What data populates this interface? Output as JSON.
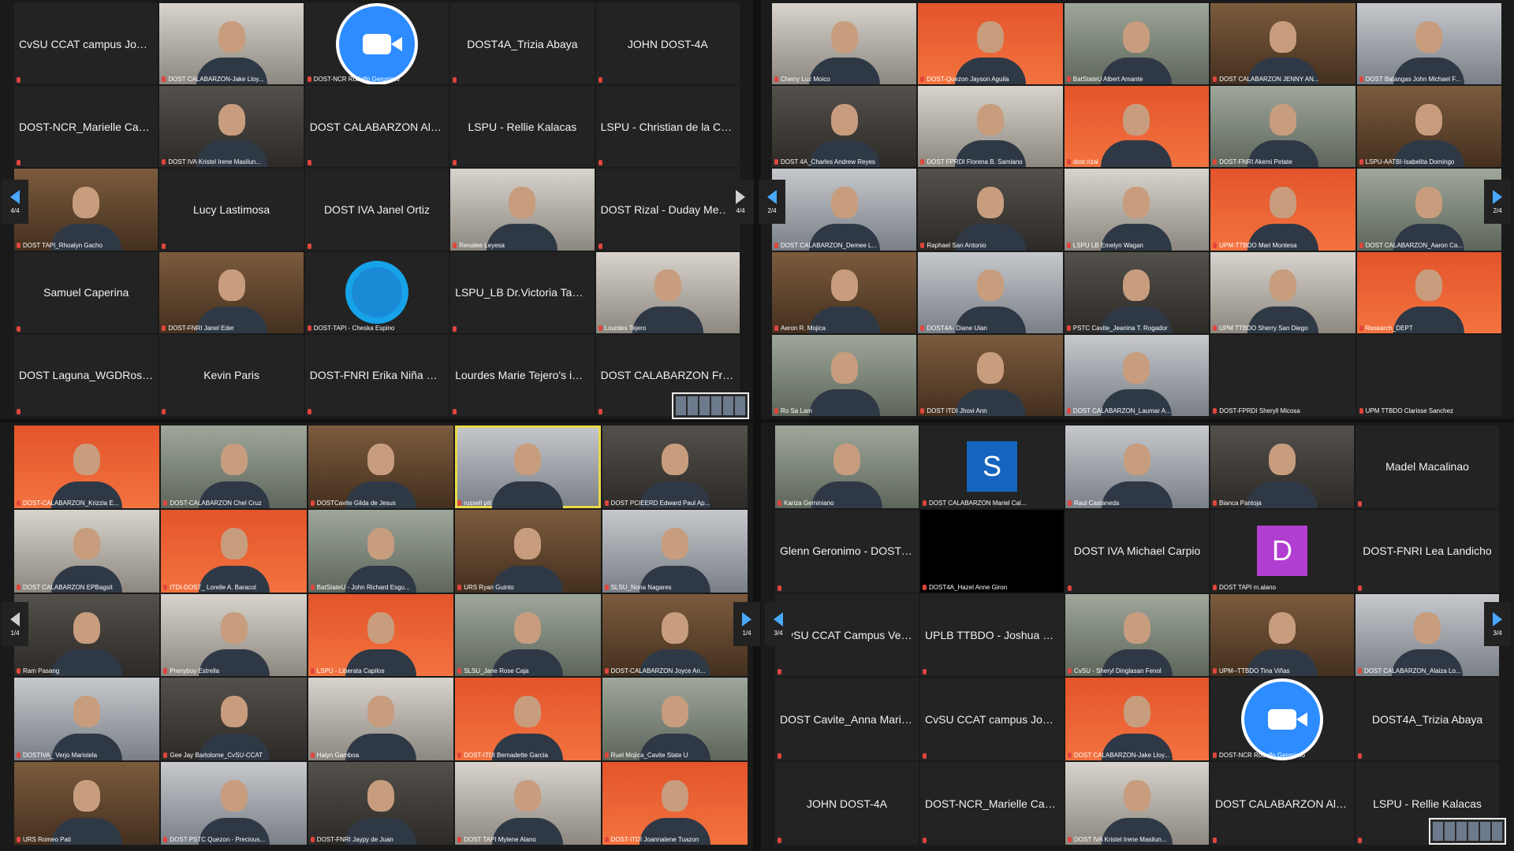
{
  "window_title": "Zoom Meeting - Gallery View Collage",
  "panels": [
    {
      "id": "top-left",
      "page": "4/4",
      "tiles": [
        {
          "name": "CvSU CCAT campus John...",
          "mode": "text"
        },
        {
          "name": "DOST CALABARZON-Jake Lloy...",
          "mode": "cam"
        },
        {
          "name": "DOST-NCR Rodolfo Geronimo",
          "mode": "zoom"
        },
        {
          "name": "DOST4A_Trizia Abaya",
          "mode": "text"
        },
        {
          "name": "JOHN DOST-4A",
          "mode": "text"
        },
        {
          "name": "DOST-NCR_Marielle Canlas",
          "mode": "text"
        },
        {
          "name": "DOST IVA Kristel Irene Masilun...",
          "mode": "cam"
        },
        {
          "name": "DOST CALABARZON Aldwi...",
          "mode": "text"
        },
        {
          "name": "LSPU - Rellie Kalacas",
          "mode": "text"
        },
        {
          "name": "LSPU - Christian de la Cruz",
          "mode": "text"
        },
        {
          "name": "DOST TAPI_Rhoalyn Gacho",
          "mode": "cam"
        },
        {
          "name": "Lucy Lastimosa",
          "mode": "text"
        },
        {
          "name": "DOST IVA Janel Ortiz",
          "mode": "text"
        },
        {
          "name": "Renalee Leyesa",
          "mode": "cam"
        },
        {
          "name": "DOST Rizal - Duday Medina",
          "mode": "text"
        },
        {
          "name": "Samuel Caperina",
          "mode": "text"
        },
        {
          "name": "DOST-FNRI Janel Eder",
          "mode": "cam"
        },
        {
          "name": "DOST-TAPI - Cheska Espino",
          "mode": "logo"
        },
        {
          "name": "LSPU_LB Dr.Victoria Tamban",
          "mode": "text"
        },
        {
          "name": "Lourdes Tejero",
          "mode": "cam"
        },
        {
          "name": "DOST Laguna_WGDRosario",
          "mode": "text"
        },
        {
          "name": "Kevin Paris",
          "mode": "text"
        },
        {
          "name": "DOST-FNRI Erika Niña Bac...",
          "mode": "text"
        },
        {
          "name": "Lourdes Marie Tejero's iPad",
          "mode": "text"
        },
        {
          "name": "DOST CALABARZON Fran...",
          "mode": "text"
        }
      ]
    },
    {
      "id": "top-right",
      "page": "2/4",
      "tiles": [
        {
          "name": "Cherry Luz Moico",
          "mode": "cam"
        },
        {
          "name": "DOST-Quezon Jayson Aguila",
          "mode": "cam"
        },
        {
          "name": "BatStateU Albert Amante",
          "mode": "cam"
        },
        {
          "name": "DOST CALABARZON JENNY AN...",
          "mode": "cam"
        },
        {
          "name": "DOST Batangas John Michael F...",
          "mode": "cam"
        },
        {
          "name": "DOST 4A_Charles Andrew Reyes",
          "mode": "cam"
        },
        {
          "name": "DOST FPRDI Florena B. Samiano",
          "mode": "cam"
        },
        {
          "name": "dost rizal",
          "mode": "cam"
        },
        {
          "name": "DOST-FNRI Akemi Petate",
          "mode": "cam"
        },
        {
          "name": "LSPU-AATBI-Isabelita Domingo",
          "mode": "cam"
        },
        {
          "name": "DOST CALABARZON_Demee L...",
          "mode": "cam"
        },
        {
          "name": "Raphael San Antonio",
          "mode": "cam"
        },
        {
          "name": "LSPU LB Emelyn Wagan",
          "mode": "cam"
        },
        {
          "name": "UPM-TTBDO Mari Montesa",
          "mode": "cam"
        },
        {
          "name": "DOST CALABARZON_Aaron Ca...",
          "mode": "cam"
        },
        {
          "name": "Aeron R. Mojica",
          "mode": "cam"
        },
        {
          "name": "DOST4A- Diane Ulan",
          "mode": "cam"
        },
        {
          "name": "PSTC Cavite_Jeanina T. Rogador",
          "mode": "cam"
        },
        {
          "name": "UPM TTBDO Sherry San Diego",
          "mode": "cam"
        },
        {
          "name": "Research_DEPT",
          "mode": "cam"
        },
        {
          "name": "Ro Sa Lam",
          "mode": "cam"
        },
        {
          "name": "DOST ITDI Jhovi Ann",
          "mode": "cam"
        },
        {
          "name": "DOST CALABARZON_Laumar A...",
          "mode": "cam"
        },
        {
          "name": "DOST-FPRDI Sheryll Micosa",
          "mode": "blank"
        },
        {
          "name": "UPM TTBDO Clarisse Sanchez",
          "mode": "blank"
        }
      ]
    },
    {
      "id": "bottom-left",
      "page": "1/4",
      "tiles": [
        {
          "name": "DOST-CALABARZON_Krizzia E...",
          "mode": "cam"
        },
        {
          "name": "DOST-CALABARZON Chel Cruz",
          "mode": "cam"
        },
        {
          "name": "DOSTCavite Gilda de Jesus",
          "mode": "cam"
        },
        {
          "name": "russell pili",
          "mode": "cam",
          "active": true
        },
        {
          "name": "DOST PCIEERD Edward Paul Ap...",
          "mode": "cam"
        },
        {
          "name": "DOST CALABARZON EPBagsit",
          "mode": "cam"
        },
        {
          "name": "ITDI-DOST_ Lorelle A. Baracol",
          "mode": "cam"
        },
        {
          "name": "BatStateU - John Richard Esgu...",
          "mode": "cam"
        },
        {
          "name": "URS Ryan Guinto",
          "mode": "cam"
        },
        {
          "name": "SLSU_Nona Nagares",
          "mode": "cam"
        },
        {
          "name": "Ram Pasang",
          "mode": "cam"
        },
        {
          "name": "Prenyboy Estrella",
          "mode": "cam"
        },
        {
          "name": "LSPU - Liberata Capilos",
          "mode": "cam"
        },
        {
          "name": "SLSU_Jane Rose Caja",
          "mode": "cam"
        },
        {
          "name": "DOST-CALABARZON Joyce An...",
          "mode": "cam"
        },
        {
          "name": "DOSTIVA_ Verjo Maristela",
          "mode": "cam"
        },
        {
          "name": "Gee Jay Bartolome_CvSU-CCAT",
          "mode": "cam"
        },
        {
          "name": "Halyn Gamboa",
          "mode": "cam"
        },
        {
          "name": "DOST-ITDI Bernadette Garcia",
          "mode": "cam"
        },
        {
          "name": "Ruel Mojica_Cavite State U",
          "mode": "cam"
        },
        {
          "name": "URS Romeo Pati",
          "mode": "cam"
        },
        {
          "name": "DOST PSTC Quezon - Precious...",
          "mode": "cam"
        },
        {
          "name": "DOST-FNRI Jaypy de Juan",
          "mode": "cam"
        },
        {
          "name": "DOST TAPI Mylene Alano",
          "mode": "cam"
        },
        {
          "name": "DOST-ITDI Joannalene Tuazon",
          "mode": "cam"
        }
      ]
    },
    {
      "id": "bottom-right",
      "page": "3/4",
      "tiles": [
        {
          "name": "Kariza Geminiano",
          "mode": "cam"
        },
        {
          "name": "DOST CALABARZON Mariel Cal...",
          "mode": "letter",
          "letter": "S",
          "color": "#1565c0"
        },
        {
          "name": "Raul Castaneda",
          "mode": "cam"
        },
        {
          "name": "Bianca Pantoja",
          "mode": "cam"
        },
        {
          "name": "Madel Macalinao",
          "mode": "text"
        },
        {
          "name": "Glenn Geronimo - DOST C...",
          "mode": "text"
        },
        {
          "name": "DOST4A_Hazel Anne Giron",
          "mode": "black"
        },
        {
          "name": "DOST IVA Michael Carpio",
          "mode": "text"
        },
        {
          "name": "DOST TAPI m.alano",
          "mode": "letter",
          "letter": "D",
          "color": "#b13ed1"
        },
        {
          "name": "DOST-FNRI Lea Landicho",
          "mode": "text"
        },
        {
          "name": "CvSU CCAT Campus Venn...",
          "mode": "text"
        },
        {
          "name": "UPLB TTBDO - Joshua Bac...",
          "mode": "text"
        },
        {
          "name": "CvSU - Sheryl Dinglasan Fenol",
          "mode": "cam"
        },
        {
          "name": "UPM--TTBDO Tina Viñas",
          "mode": "cam"
        },
        {
          "name": "DOST CALABARZON_Alaiza Lo...",
          "mode": "cam"
        },
        {
          "name": "DOST Cavite_Anna Marie S...",
          "mode": "text"
        },
        {
          "name": "CvSU CCAT campus John...",
          "mode": "text"
        },
        {
          "name": "DOST CALABARZON-Jake Lloy...",
          "mode": "cam"
        },
        {
          "name": "DOST-NCR Rodolfo Geronimo",
          "mode": "zoom"
        },
        {
          "name": "DOST4A_Trizia Abaya",
          "mode": "text"
        },
        {
          "name": "JOHN DOST-4A",
          "mode": "text"
        },
        {
          "name": "DOST-NCR_Marielle Canlas",
          "mode": "text"
        },
        {
          "name": "DOST IVA Kristel Irene Masilun...",
          "mode": "cam"
        },
        {
          "name": "DOST CALABARZON Aldwi...",
          "mode": "text"
        },
        {
          "name": "LSPU - Rellie Kalacas",
          "mode": "text"
        }
      ]
    }
  ]
}
